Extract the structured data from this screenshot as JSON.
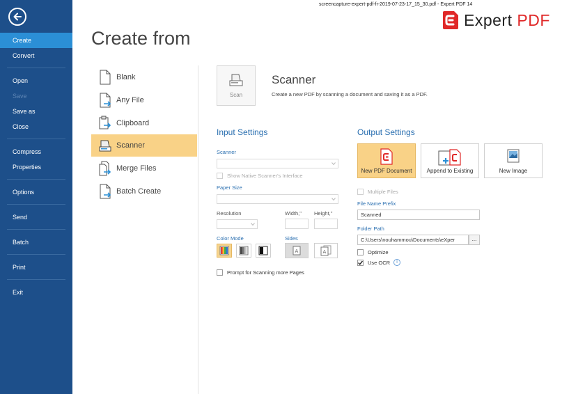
{
  "window": {
    "title": "screencapture-expert-pdf-fr-2019-07-23-17_15_30.pdf   -   Expert PDF 14",
    "logo_text_main": "Expert ",
    "logo_text_accent": "PDF",
    "brand_color": "#e02828",
    "sidebar_color": "#1d4f8a",
    "sidebar_active_color": "#2b8fd6",
    "highlight_color": "#f9d287"
  },
  "sidebar": {
    "back_icon": "arrow-left-circle-icon",
    "items": [
      {
        "label": "Create",
        "state": "active"
      },
      {
        "label": "Convert",
        "state": "normal"
      },
      {
        "label": "Open",
        "state": "normal"
      },
      {
        "label": "Save",
        "state": "disabled"
      },
      {
        "label": "Save as",
        "state": "normal"
      },
      {
        "label": "Close",
        "state": "normal"
      },
      {
        "label": "Compress",
        "state": "normal"
      },
      {
        "label": "Properties",
        "state": "normal"
      },
      {
        "label": "Options",
        "state": "normal"
      },
      {
        "label": "Send",
        "state": "normal"
      },
      {
        "label": "Batch",
        "state": "normal"
      },
      {
        "label": "Print",
        "state": "normal"
      },
      {
        "label": "Exit",
        "state": "normal"
      }
    ]
  },
  "page_title": "Create from",
  "sources": [
    {
      "label": "Blank",
      "icon": "blank-page-icon",
      "selected": false
    },
    {
      "label": "Any File",
      "icon": "any-file-icon",
      "selected": false
    },
    {
      "label": "Clipboard",
      "icon": "clipboard-icon",
      "selected": false
    },
    {
      "label": "Scanner",
      "icon": "scanner-icon",
      "selected": true
    },
    {
      "label": "Merge Files",
      "icon": "merge-files-icon",
      "selected": false
    },
    {
      "label": "Batch Create",
      "icon": "batch-create-icon",
      "selected": false
    }
  ],
  "panel": {
    "scan_button_label": "Scan",
    "title": "Scanner",
    "description": "Create a new PDF by scanning a document and saving it as a PDF."
  },
  "input_settings": {
    "title": "Input Settings",
    "scanner_label": "Scanner",
    "scanner_value": "",
    "native_interface_label": "Show Native Scanner's Interface",
    "paper_size_label": "Paper Size",
    "paper_size_value": "",
    "resolution_label": "Resolution",
    "width_label": "Width,\"",
    "height_label": "Height,\"",
    "color_mode_label": "Color Mode",
    "color_modes": [
      {
        "name": "color-mode-icon",
        "selected": true
      },
      {
        "name": "grayscale-mode-icon",
        "selected": false
      },
      {
        "name": "black-white-mode-icon",
        "selected": false
      }
    ],
    "sides_label": "Sides",
    "sides": [
      {
        "name": "single-side-icon",
        "selected": true
      },
      {
        "name": "double-side-icon",
        "selected": false
      }
    ],
    "prompt_more_pages_label": "Prompt for Scanning more Pages",
    "prompt_more_pages_checked": false
  },
  "output_settings": {
    "title": "Output Settings",
    "buttons": [
      {
        "label": "New PDF Document",
        "selected": true
      },
      {
        "label": "Append to Existing",
        "selected": false
      },
      {
        "label": "New Image",
        "selected": false
      }
    ],
    "multiple_files_label": "Multiple Files",
    "file_name_prefix_label": "File Name Prefix",
    "file_name_prefix_value": "Scanned",
    "folder_path_label": "Folder Path",
    "folder_path_value": "C:\\Users\\nouhammou\\Documents\\eXper",
    "browse_label": "...",
    "optimize_label": "Optimize",
    "optimize_checked": false,
    "use_ocr_label": "Use OCR",
    "use_ocr_checked": true,
    "info_label": "i"
  }
}
